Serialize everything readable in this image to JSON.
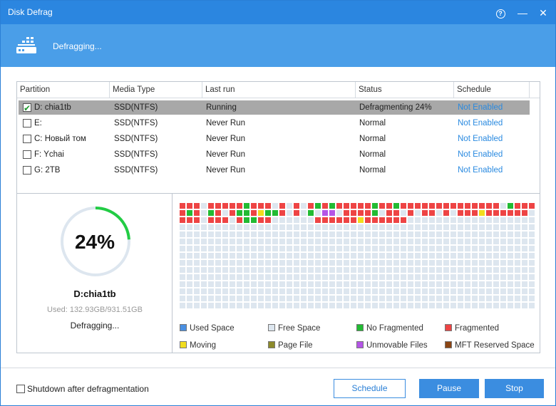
{
  "window": {
    "title": "Disk Defrag"
  },
  "titlebar": {
    "help_icon": "?",
    "minimize_icon": "—",
    "close_icon": "✕"
  },
  "header": {
    "status_text": "Defragging..."
  },
  "table": {
    "columns": [
      "Partition",
      "Media Type",
      "Last run",
      "Status",
      "Schedule"
    ],
    "rows": [
      {
        "checked": true,
        "partition": "D:  chia1tb",
        "media": "SSD(NTFS)",
        "last_run": "Running",
        "status": "Defragmenting 24%",
        "schedule": "Not Enabled",
        "selected": true
      },
      {
        "checked": false,
        "partition": "E:",
        "media": "SSD(NTFS)",
        "last_run": "Never Run",
        "status": "Normal",
        "schedule": "Not Enabled",
        "selected": false
      },
      {
        "checked": false,
        "partition": "C:  Новый том",
        "media": "SSD(NTFS)",
        "last_run": "Never Run",
        "status": "Normal",
        "schedule": "Not Enabled",
        "selected": false
      },
      {
        "checked": false,
        "partition": "F:  Ychai",
        "media": "SSD(NTFS)",
        "last_run": "Never Run",
        "status": "Normal",
        "schedule": "Not Enabled",
        "selected": false
      },
      {
        "checked": false,
        "partition": "G:  2TB",
        "media": "SSD(NTFS)",
        "last_run": "Never Run",
        "status": "Normal",
        "schedule": "Not Enabled",
        "selected": false
      }
    ]
  },
  "progress": {
    "percent_label": "24%",
    "percent": 24,
    "drive": "D:chia1tb",
    "used": "Used: 132.93GB/931.51GB",
    "state": "Defragging..."
  },
  "cluster_map": {
    "columns": 25,
    "rows": 15,
    "row_codes": [
      "RRRFRRRRRGRRRFRFRFRGRGRRRRRGRRGRRRRRRRRRRRRRRFGRRRR",
      "RGRFGRFRGGRYGGRFRFGFPPFRRRRGFRRFRFRRFRFRRRYRRRRRR",
      "RRRFRRRFRGGRRFFFFFFRRRRRRYRRRRRRFFFFFFFFFFFFFFFFFF"
    ],
    "colors": {
      "used": "#4a90e2",
      "free": "#dde6ef",
      "no_fragmented": "#22bb33",
      "fragmented": "#ee4444",
      "moving": "#f2dd1e",
      "page_file": "#8c8a2a",
      "unmovable": "#b455e6",
      "mft_reserved": "#8b4513"
    }
  },
  "legend": [
    {
      "label": "Used Space",
      "color": "#4a90e2"
    },
    {
      "label": "Free Space",
      "color": "#dde6ef"
    },
    {
      "label": "No Fragmented",
      "color": "#22bb33"
    },
    {
      "label": "Fragmented",
      "color": "#ee4444"
    },
    {
      "label": "Moving",
      "color": "#f2dd1e"
    },
    {
      "label": "Page File",
      "color": "#8c8a2a"
    },
    {
      "label": "Unmovable Files",
      "color": "#b455e6"
    },
    {
      "label": "MFT Reserved Space",
      "color": "#8b4513"
    }
  ],
  "footer": {
    "shutdown_label": "Shutdown after defragmentation",
    "schedule_label": "Schedule",
    "pause_label": "Pause",
    "stop_label": "Stop"
  },
  "icons": {
    "header": "disk-drive-icon",
    "gauge": "progress-ring-icon"
  }
}
